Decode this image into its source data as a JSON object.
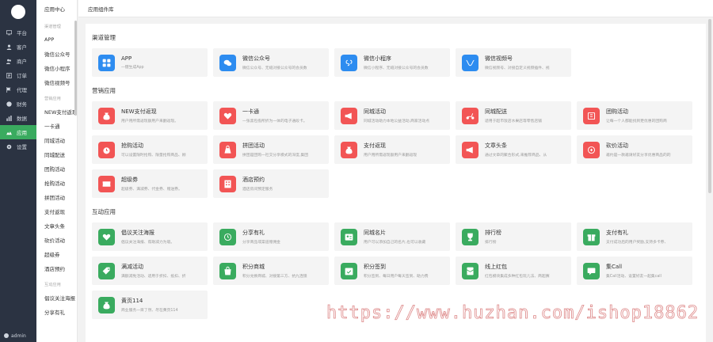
{
  "colors": {
    "nav_bg": "#2b3342",
    "nav_active": "#3aab5f",
    "blue": "#2d8cf0",
    "red": "#f25555",
    "green": "#3aab5f"
  },
  "nav": {
    "items": [
      {
        "label": "平台",
        "icon": "monitor-icon"
      },
      {
        "label": "客户",
        "icon": "user-icon"
      },
      {
        "label": "商户",
        "icon": "users-icon"
      },
      {
        "label": "订单",
        "icon": "list-icon"
      },
      {
        "label": "代理",
        "icon": "flag-icon"
      },
      {
        "label": "财务",
        "icon": "money-icon"
      },
      {
        "label": "数据",
        "icon": "bars-icon"
      },
      {
        "label": "应用",
        "icon": "apps-icon"
      },
      {
        "label": "设置",
        "icon": "gear-icon"
      }
    ],
    "user": "admin"
  },
  "sub": {
    "head": "应用中心",
    "group1": "渠道管理",
    "group1_items": [
      "APP",
      "微信公众号",
      "微信小程序",
      "微信视频号"
    ],
    "group2": "营销应用",
    "group2_items": [
      "NEW支付返现",
      "一卡通",
      "同城活动",
      "同城配送",
      "团购活动",
      "抢购活动",
      "拼团活动",
      "支付返现",
      "文章头条",
      "砍价活动",
      "超级券",
      "酒店预约"
    ],
    "group3": "互动应用",
    "group3_items": [
      "倡议关注海报",
      "分享有礼"
    ]
  },
  "header": {
    "title": "应用组件库"
  },
  "sections": [
    {
      "title": "渠道管理",
      "tiles": [
        {
          "title": "APP",
          "desc": "一键生成App",
          "color": "#2d8cf0",
          "icon": "app-grid-icon"
        },
        {
          "title": "微信公众号",
          "desc": "微信公众号、无缝对接公众号的会员数",
          "color": "#2d8cf0",
          "icon": "wechat-icon"
        },
        {
          "title": "微信小程序",
          "desc": "微信小程序、无缝对接公众号的会员数",
          "color": "#2d8cf0",
          "icon": "mini-program-icon"
        },
        {
          "title": "微信视频号",
          "desc": "微信视频号、对接自定义视频插件、视",
          "color": "#2d8cf0",
          "icon": "video-channel-icon"
        }
      ]
    },
    {
      "title": "营销应用",
      "tiles": [
        {
          "title": "NEW支付返现",
          "desc": "用户用所需返现额用户来翻返现。",
          "color": "#f25555",
          "icon": "money-bag-icon"
        },
        {
          "title": "一卡通",
          "desc": "一张黑包揽所折为一体的电子通段卡。",
          "color": "#f25555",
          "icon": "heart-card-icon"
        },
        {
          "title": "同城活动",
          "desc": "同城活动助力本地公益活动,商家活动点",
          "color": "#f25555",
          "icon": "megaphone-icon"
        },
        {
          "title": "同城配送",
          "desc": "适用于超市饭店水果店等零售店铺",
          "color": "#f25555",
          "icon": "scooter-icon"
        },
        {
          "title": "团购活动",
          "desc": "让每一个人都能找到更优惠的团购商",
          "color": "#f25555",
          "icon": "group-buy-icon"
        },
        {
          "title": "抢购活动",
          "desc": "可以设置限时抢购、限量抢购商品、顾",
          "color": "#f25555",
          "icon": "clock-icon"
        },
        {
          "title": "拼团活动",
          "desc": "拼团是团购一社交分享模式的深度,集团",
          "color": "#f25555",
          "icon": "shopping-icon"
        },
        {
          "title": "支付返现",
          "desc": "用户用所需返现额用户来翻返现",
          "color": "#f25555",
          "icon": "money-bag-icon"
        },
        {
          "title": "文章头条",
          "desc": "通过文章的聚合形式,来推荐商品、从",
          "color": "#f25555",
          "icon": "megaphone-icon"
        },
        {
          "title": "砍价活动",
          "desc": "邀约是一款邀请好友分享优惠商品的的",
          "color": "#f25555",
          "icon": "bargain-icon"
        },
        {
          "title": "超级券",
          "desc": "超级券、满减券、代金券、赠送券。",
          "color": "#f25555",
          "icon": "coupon-icon"
        },
        {
          "title": "酒店预约",
          "desc": "酒店房间预定服务",
          "color": "#f25555",
          "icon": "hotel-icon"
        }
      ]
    },
    {
      "title": "互动应用",
      "tiles": [
        {
          "title": "倡议关注海报",
          "desc": "倡议关注海报、帮助减力为吸。",
          "color": "#3aab5f",
          "icon": "heart-icon"
        },
        {
          "title": "分享有礼",
          "desc": "分享商品或渠道赠佣金",
          "color": "#3aab5f",
          "icon": "timer-icon"
        },
        {
          "title": "同城名片",
          "desc": "用户可以添加自己的名片,也可以收藏",
          "color": "#3aab5f",
          "icon": "name-card-icon"
        },
        {
          "title": "排行榜",
          "desc": "排行榜",
          "color": "#3aab5f",
          "icon": "trophy-icon"
        },
        {
          "title": "支付有礼",
          "desc": "支付成功后的用户奖励,支持多卡券、",
          "color": "#3aab5f",
          "icon": "gift-icon"
        },
        {
          "title": "满减活动",
          "desc": "满额减免活动、适用于折扣、抵扣、折",
          "color": "#3aab5f",
          "icon": "tag-icon"
        },
        {
          "title": "积分商城",
          "desc": "积分兑换商城、对接第三方、抗九连锁",
          "color": "#3aab5f",
          "icon": "shop-bag-icon"
        },
        {
          "title": "积分签到",
          "desc": "积分签到、每日用户每天签到、助力费",
          "color": "#3aab5f",
          "icon": "calendar-check-icon"
        },
        {
          "title": "线上红包",
          "desc": "红包模块集成多种红包玩儿法、商超赛",
          "color": "#3aab5f",
          "icon": "red-packet-icon"
        },
        {
          "title": "集Call",
          "desc": "集Call活动、设置好友一起集call",
          "color": "#3aab5f",
          "icon": "chat-icon"
        },
        {
          "title": "黄页114",
          "desc": "商业服务一目了然、尽在黄页114",
          "color": "#3aab5f",
          "icon": "money-bag-icon"
        }
      ]
    }
  ],
  "watermark": "https://www.huzhan.com/ishop18862"
}
